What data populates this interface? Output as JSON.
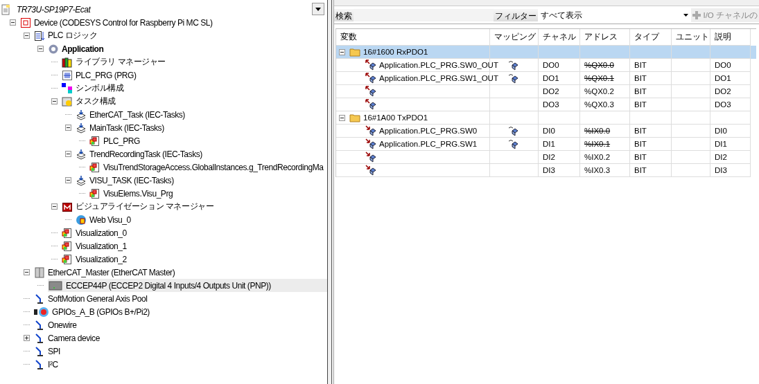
{
  "project": {
    "title": "TR73U-SP19P7-Ecat"
  },
  "tree": [
    {
      "label": "Device (CODESYS Control for Raspberry Pi MC SL)",
      "kind": "device",
      "expanded": true,
      "selected": false,
      "children": [
        {
          "label": "PLC ロジック",
          "kind": "plc-logic",
          "expanded": true,
          "selected": false,
          "children": [
            {
              "label": "Application",
              "kind": "application",
              "bold": true,
              "expanded": true,
              "selected": false,
              "children": [
                {
                  "label": "ライブラリ マネージャー",
                  "kind": "library",
                  "selected": false
                },
                {
                  "label": "PLC_PRG (PRG)",
                  "kind": "pou",
                  "selected": false
                },
                {
                  "label": "シンボル構成",
                  "kind": "symbol",
                  "selected": false
                },
                {
                  "label": "タスク構成",
                  "kind": "task-config",
                  "expanded": true,
                  "selected": false,
                  "children": [
                    {
                      "label": "EtherCAT_Task (IEC-Tasks)",
                      "kind": "task",
                      "selected": false
                    },
                    {
                      "label": "MainTask (IEC-Tasks)",
                      "kind": "task",
                      "expanded": true,
                      "selected": false,
                      "children": [
                        {
                          "label": "PLC_PRG",
                          "kind": "call",
                          "selected": false
                        }
                      ]
                    },
                    {
                      "label": "TrendRecordingTask (IEC-Tasks)",
                      "kind": "task",
                      "expanded": true,
                      "selected": false,
                      "children": [
                        {
                          "label": "VisuTrendStorageAccess.GlobalInstances.g_TrendRecordingMa",
                          "kind": "call",
                          "selected": false
                        }
                      ]
                    },
                    {
                      "label": "VISU_TASK (IEC-Tasks)",
                      "kind": "task",
                      "expanded": true,
                      "selected": false,
                      "children": [
                        {
                          "label": "VisuElems.Visu_Prg",
                          "kind": "call",
                          "selected": false
                        }
                      ]
                    }
                  ]
                },
                {
                  "label": "ビジュアライゼーション マネージャー",
                  "kind": "visu-manager",
                  "expanded": true,
                  "selected": false,
                  "children": [
                    {
                      "label": "Web Visu_0",
                      "kind": "web-visu",
                      "selected": false
                    }
                  ]
                },
                {
                  "label": "Visualization_0",
                  "kind": "visu",
                  "selected": false
                },
                {
                  "label": "Visualization_1",
                  "kind": "visu",
                  "selected": false
                },
                {
                  "label": "Visualization_2",
                  "kind": "visu",
                  "selected": false
                }
              ]
            }
          ]
        },
        {
          "label": "EtherCAT_Master (EtherCAT Master)",
          "kind": "master",
          "expanded": true,
          "selected": false,
          "children": [
            {
              "label": "ECCEP44P (ECCEP2 Digital 4 Inputs/4 Outputs Unit (PNP))",
              "kind": "slave",
              "selected": true
            }
          ]
        },
        {
          "label": "SoftMotion General Axis Pool",
          "kind": "connector",
          "selected": false
        },
        {
          "label": "GPIOs_A_B (GPIOs B+/Pi2)",
          "kind": "gpio",
          "selected": false
        },
        {
          "label": "Onewire",
          "kind": "connector",
          "selected": false
        },
        {
          "label": "Camera device",
          "kind": "connector",
          "expanded": false,
          "selected": false
        },
        {
          "label": "SPI",
          "kind": "connector",
          "selected": false
        },
        {
          "label": "I²C",
          "kind": "connector",
          "selected": false
        }
      ]
    }
  ],
  "toolbar": {
    "search_label": "検索",
    "filter_label": "フィルター",
    "filter_value": "すべて表示",
    "add_button": "I/O チャネルの"
  },
  "table": {
    "columns": [
      "変数",
      "マッピング",
      "チャネル",
      "アドレス",
      "タイプ",
      "ユニット",
      "説明"
    ],
    "groups": [
      {
        "label": "16#1600 RxPDO1",
        "expanded": true,
        "selected": true,
        "rows": [
          {
            "kind": "output",
            "variable": "Application.PLC_PRG.SW0_OUT",
            "mapped": true,
            "channel": "DO0",
            "address": "%QX0.0",
            "address_struck": true,
            "type": "BIT",
            "description": "DO0"
          },
          {
            "kind": "output",
            "variable": "Application.PLC_PRG.SW1_OUT",
            "mapped": true,
            "channel": "DO1",
            "address": "%QX0.1",
            "address_struck": true,
            "type": "BIT",
            "description": "DO1"
          },
          {
            "kind": "output",
            "mapped": false,
            "channel": "DO2",
            "address": "%QX0.2",
            "address_struck": false,
            "type": "BIT",
            "description": "DO2"
          },
          {
            "kind": "output",
            "mapped": false,
            "channel": "DO3",
            "address": "%QX0.3",
            "address_struck": false,
            "type": "BIT",
            "description": "DO3"
          }
        ]
      },
      {
        "label": "16#1A00 TxPDO1",
        "expanded": true,
        "selected": false,
        "rows": [
          {
            "kind": "input",
            "variable": "Application.PLC_PRG.SW0",
            "mapped": true,
            "channel": "DI0",
            "address": "%IX0.0",
            "address_struck": true,
            "type": "BIT",
            "description": "DI0"
          },
          {
            "kind": "input",
            "variable": "Application.PLC_PRG.SW1",
            "mapped": true,
            "channel": "DI1",
            "address": "%IX0.1",
            "address_struck": true,
            "type": "BIT",
            "description": "DI1"
          },
          {
            "kind": "input",
            "mapped": false,
            "channel": "DI2",
            "address": "%IX0.2",
            "address_struck": false,
            "type": "BIT",
            "description": "DI2"
          },
          {
            "kind": "input",
            "mapped": false,
            "channel": "DI3",
            "address": "%IX0.3",
            "address_struck": false,
            "type": "BIT",
            "description": "DI3"
          }
        ]
      }
    ]
  }
}
